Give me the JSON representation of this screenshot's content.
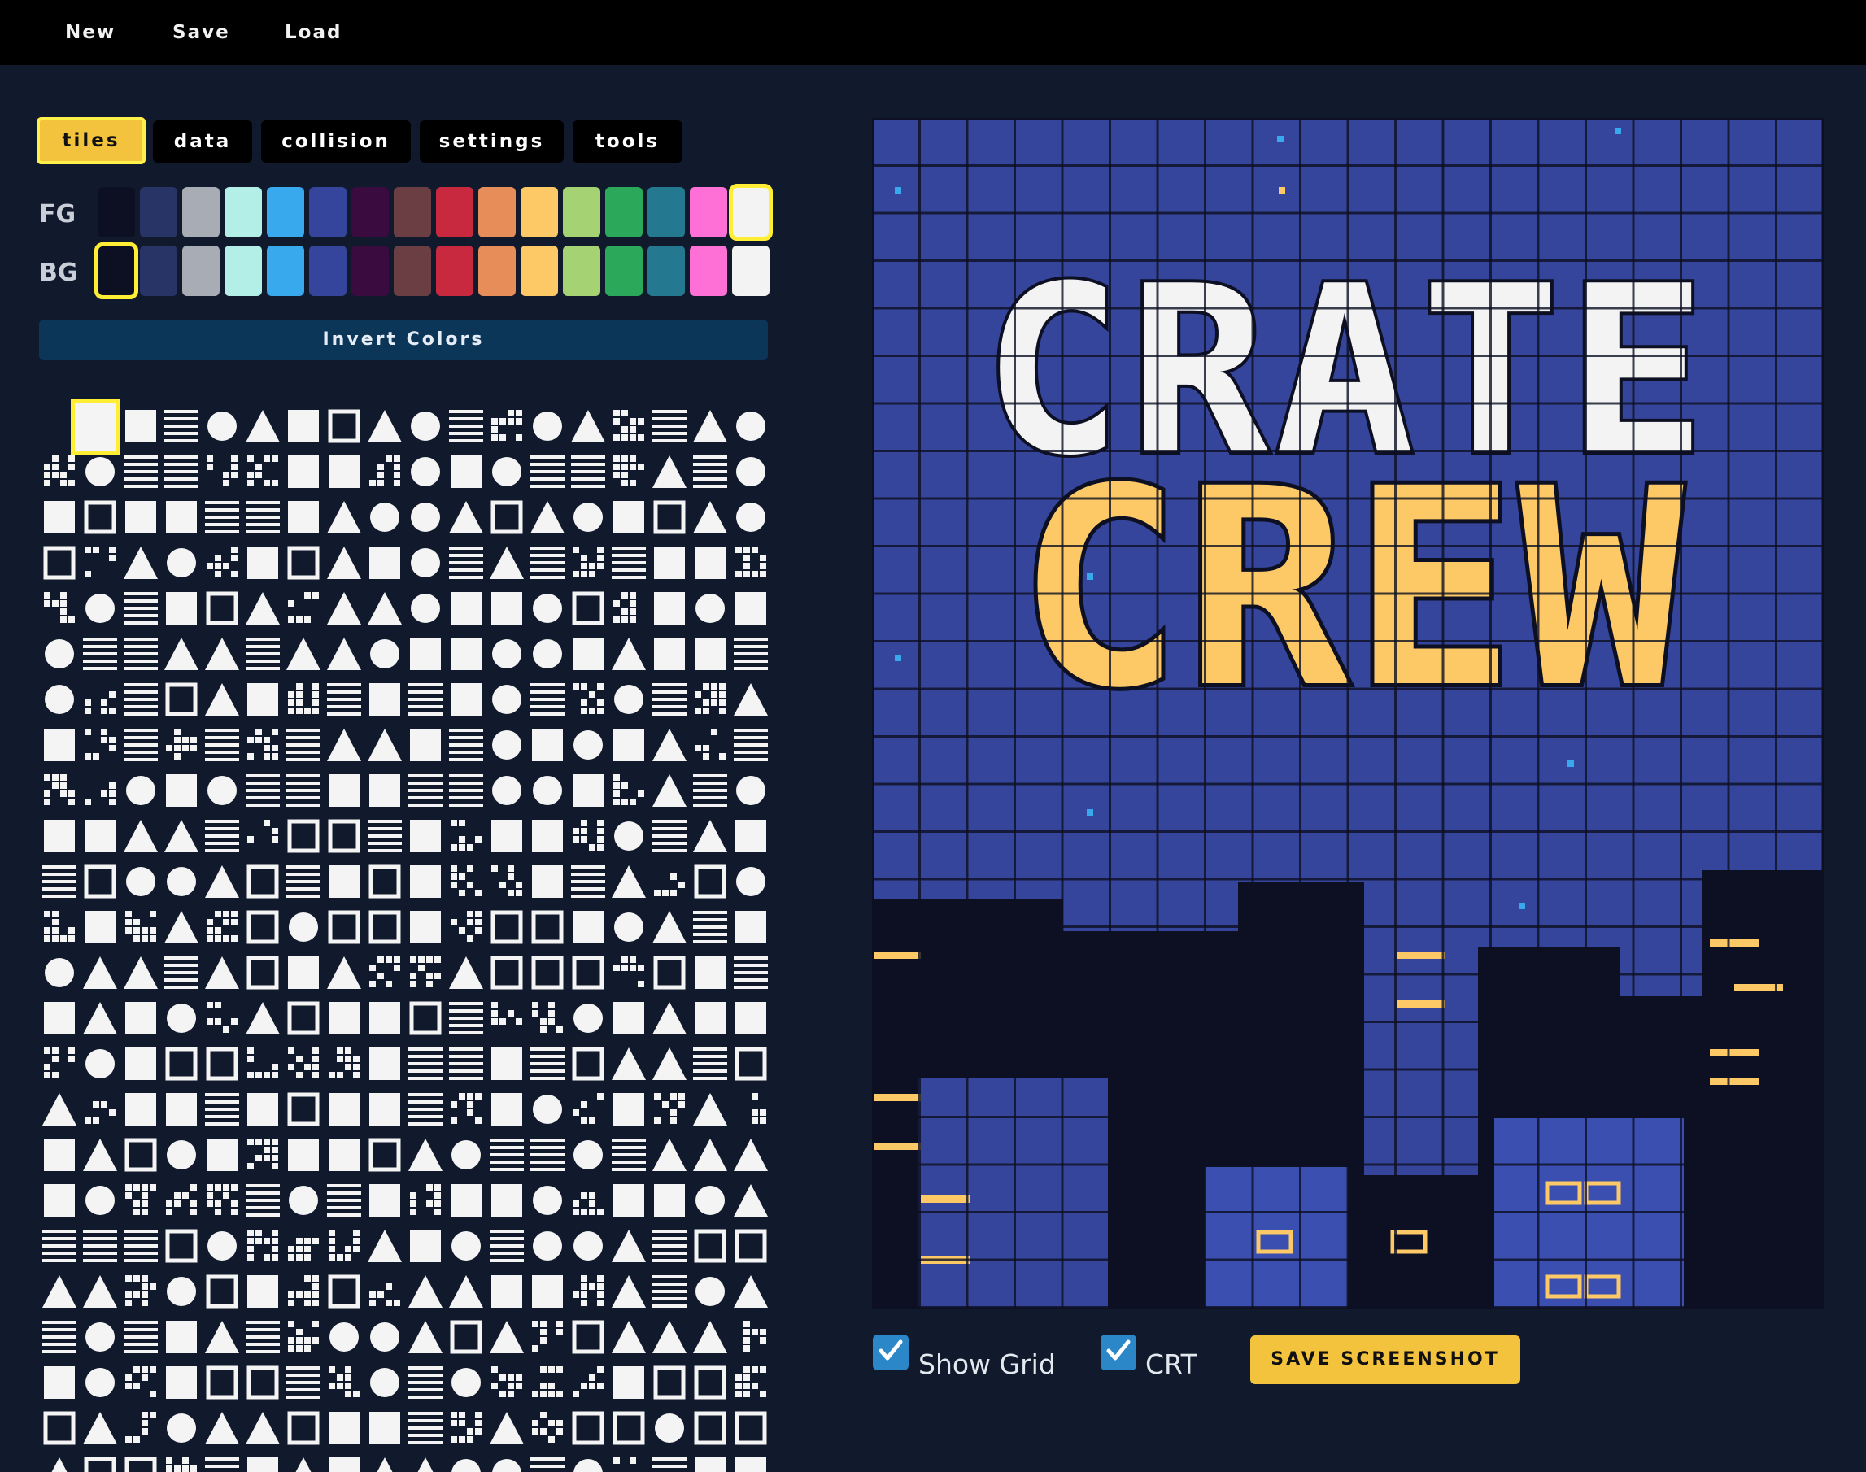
{
  "menu": {
    "new": "New",
    "save": "Save",
    "load": "Load"
  },
  "tabs": [
    {
      "label": "tiles",
      "active": true
    },
    {
      "label": "data"
    },
    {
      "label": "collision"
    },
    {
      "label": "settings"
    },
    {
      "label": "tools"
    }
  ],
  "palette": {
    "fg_label": "FG",
    "bg_label": "BG",
    "colors": [
      "#0d1022",
      "#283366",
      "#a8acb5",
      "#b3efe6",
      "#39a9ee",
      "#36459c",
      "#3a0b3f",
      "#6b3e43",
      "#c9293f",
      "#e68d5a",
      "#fdc866",
      "#a5d373",
      "#2ba85a",
      "#24788f",
      "#ff70d6",
      "#f3f3f3"
    ],
    "fg_selected": 15,
    "bg_selected": 0
  },
  "invert_label": "Invert Colors",
  "canvas": {
    "title_top": "CRATE",
    "title_bottom": "CREW",
    "text_color": "#f3f3f3",
    "title_color": "#fdc866",
    "bg_color": "#36459c"
  },
  "controls": {
    "show_grid_label": "Show Grid",
    "show_grid_checked": true,
    "crt_label": "CRT",
    "crt_checked": true,
    "save_screenshot_label": "SAVE SCREENSHOT"
  }
}
